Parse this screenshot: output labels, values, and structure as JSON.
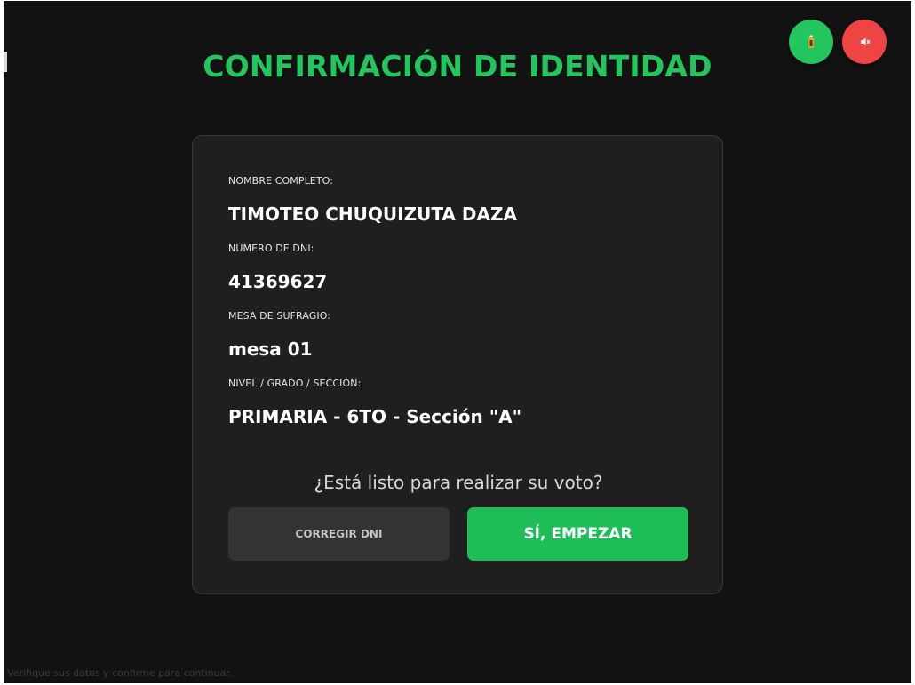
{
  "title": "CONFIRMACIÓN DE IDENTIDAD",
  "fields": [
    {
      "label": "NOMBRE COMPLETO:",
      "value": "TIMOTEO CHUQUIZUTA DAZA"
    },
    {
      "label": "NÚMERO DE DNI:",
      "value": "41369627"
    },
    {
      "label": "MESA DE SUFRAGIO:",
      "value": "mesa 01"
    },
    {
      "label": "NIVEL / GRADO / SECCIÓN:",
      "value": "PRIMARIA - 6TO - Sección \"A\""
    }
  ],
  "prompt": "¿Está listo para realizar su voto?",
  "buttons": {
    "correct_label": "CORREGIR DNI",
    "start_label": "SÍ, EMPEZAR"
  },
  "footer_hint": "Verifique sus datos y confirme para continuar.",
  "icons": {
    "accessibility": "accessibility-icon",
    "mute": "speaker-muted-icon"
  },
  "colors": {
    "accent": "#22c55e",
    "danger": "#ef4444",
    "background": "#121212",
    "card": "#1f1f1f"
  }
}
